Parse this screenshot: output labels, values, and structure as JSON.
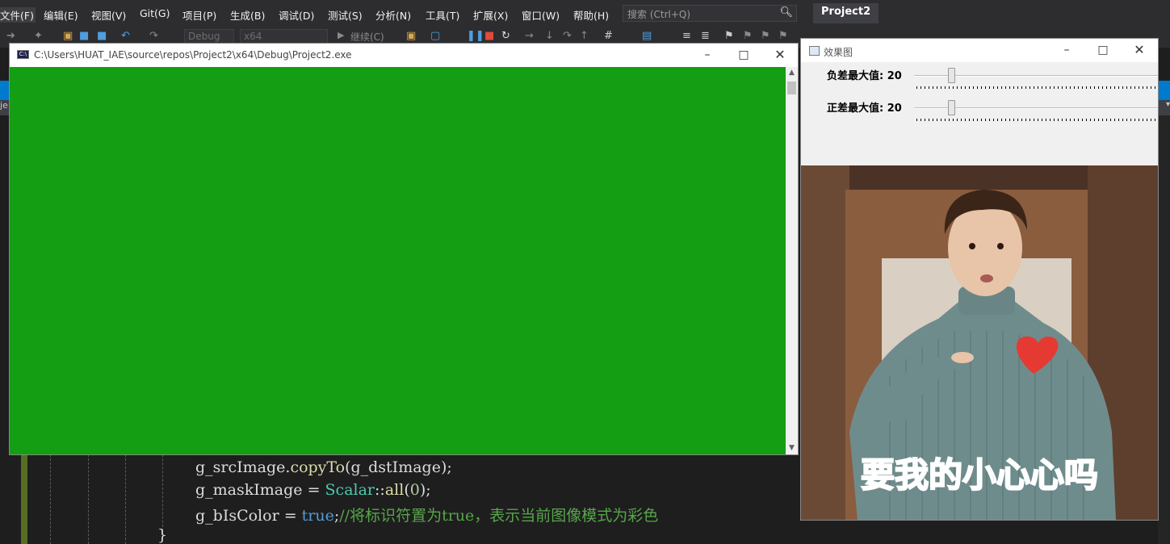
{
  "menubar": {
    "items": [
      "文件(F)",
      "编辑(E)",
      "视图(V)",
      "Git(G)",
      "项目(P)",
      "生成(B)",
      "调试(D)",
      "测试(S)",
      "分析(N)",
      "工具(T)",
      "扩展(X)",
      "窗口(W)",
      "帮助(H)"
    ],
    "search_placeholder": "搜索 (Ctrl+Q)",
    "project_title": "Project2"
  },
  "toolbar": {
    "config": "Debug",
    "platform": "x64",
    "continue_label": "继续(C)"
  },
  "left_tab_text": "je",
  "console_window": {
    "title": "C:\\Users\\HUAT_IAE\\source\\repos\\Project2\\x64\\Debug\\Project2.exe",
    "icon_text": "C:\\",
    "background_color": "#139e13"
  },
  "effect_window": {
    "title": "效果图",
    "trackbars": [
      {
        "label": "负差最大值: 20",
        "value": 20
      },
      {
        "label": "正差最大值: 20",
        "value": 20
      }
    ],
    "image_caption": "要我的小心心吗"
  },
  "code": {
    "line1": {
      "a": "g_srcImage.",
      "fn": "copyTo",
      "b": "(g_dstImage);"
    },
    "line2": {
      "a": "g_maskImage = ",
      "type": "Scalar",
      "b": "::",
      "fn": "all",
      "c": "(",
      "num": "0",
      "d": ");"
    },
    "line3": {
      "a": "g_bIsColor = ",
      "kw": "true",
      "b": ";",
      "cmt": "//将标识符置为true，表示当前图像模式为彩色"
    },
    "line4": "}"
  }
}
